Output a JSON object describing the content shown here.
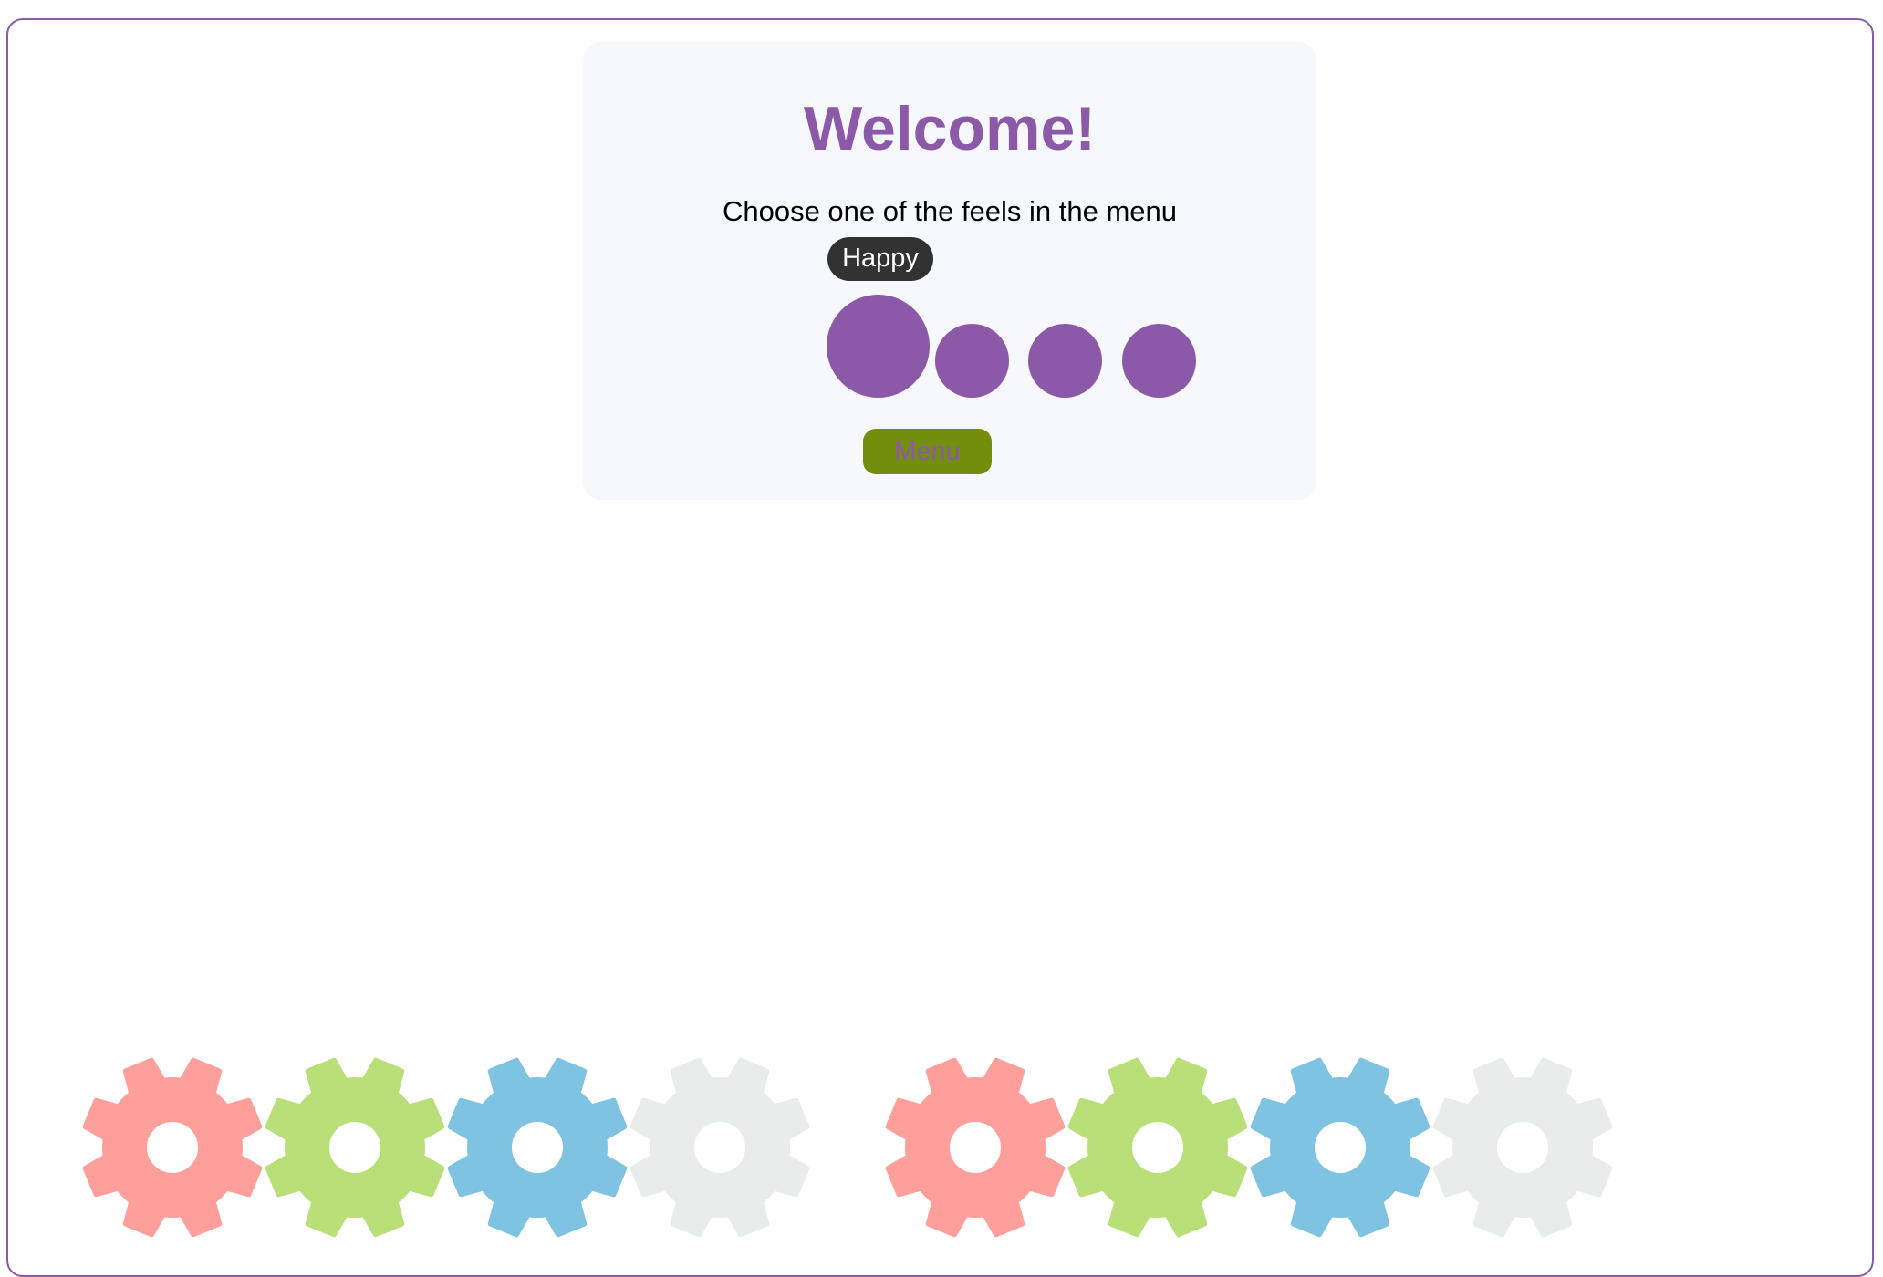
{
  "colors": {
    "accent": "#8b59a8",
    "card_background": "#f7f8fd",
    "tooltip_background": "#323232",
    "menu_button": "#738e0c"
  },
  "card": {
    "title": "Welcome!",
    "subtitle": "Choose one of the feels in the menu",
    "tooltip": "Happy",
    "menu_label": "Menu"
  },
  "feel_dots": [
    {
      "icon": "circle",
      "selected": true
    },
    {
      "icon": "circle",
      "selected": false
    },
    {
      "icon": "circle",
      "selected": false
    },
    {
      "icon": "circle",
      "selected": false
    }
  ],
  "gears": [
    {
      "icon": "gear-icon",
      "color": "#ff9f9c"
    },
    {
      "icon": "gear-icon",
      "color": "#b9e078"
    },
    {
      "icon": "gear-icon",
      "color": "#7fc3e2"
    },
    {
      "icon": "gear-icon",
      "color": "#e8eceb"
    },
    {
      "icon": "gear-icon",
      "color": "#ff9f9c"
    },
    {
      "icon": "gear-icon",
      "color": "#b9e078"
    },
    {
      "icon": "gear-icon",
      "color": "#7fc3e2"
    },
    {
      "icon": "gear-icon",
      "color": "#e8eceb"
    }
  ]
}
